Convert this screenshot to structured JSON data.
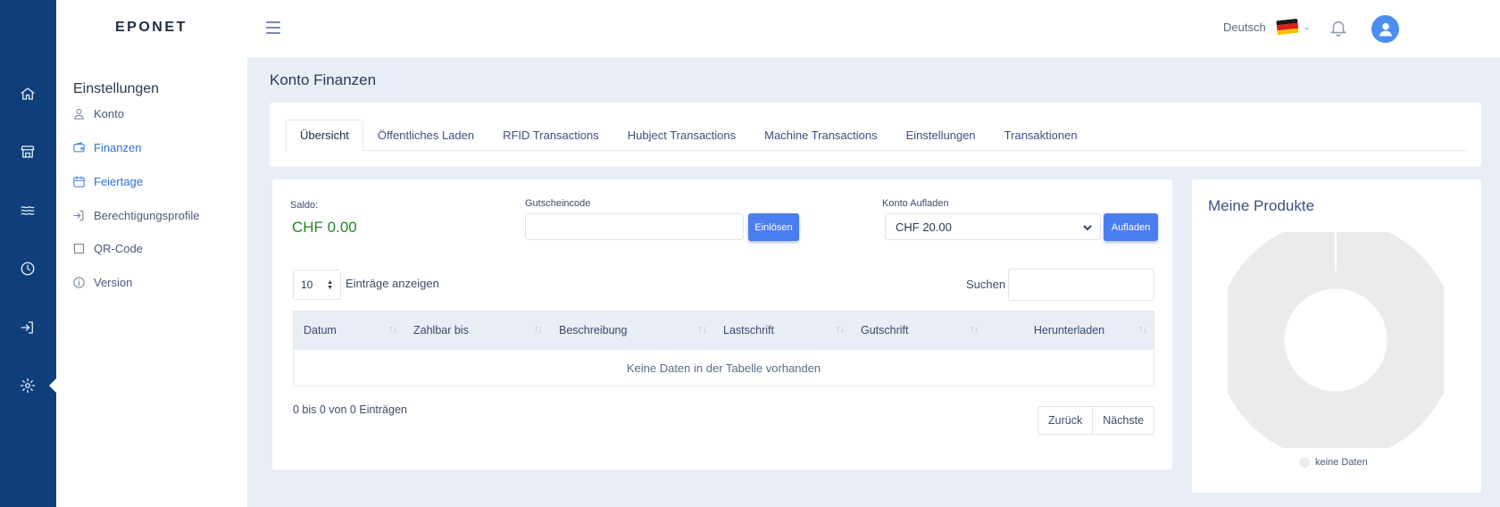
{
  "header": {
    "logo": "EPONET",
    "language": "Deutsch"
  },
  "sidebar": {
    "title": "Einstellungen",
    "items": [
      {
        "label": "Konto",
        "icon": "user-icon"
      },
      {
        "label": "Finanzen",
        "icon": "wallet-icon"
      },
      {
        "label": "Feiertage",
        "icon": "calendar-icon"
      },
      {
        "label": "Berechtigungsprofile",
        "icon": "sign-in-icon"
      },
      {
        "label": "QR-Code",
        "icon": "square-icon"
      },
      {
        "label": "Version",
        "icon": "info-icon"
      }
    ]
  },
  "page": {
    "title": "Konto Finanzen"
  },
  "tabs": [
    "Übersicht",
    "Öffentliches Laden",
    "RFID Transactions",
    "Hubject Transactions",
    "Machine Transactions",
    "Einstellungen",
    "Transaktionen"
  ],
  "finance": {
    "saldo_label": "Saldo:",
    "saldo_value": "CHF 0.00",
    "voucher_label": "Gutscheincode",
    "voucher_value": "",
    "redeem_button": "Einlösen",
    "topup_label": "Konto Aufladen",
    "topup_selected": "CHF 20.00",
    "topup_button": "Aufladen",
    "entries_value": "10",
    "entries_label": "Einträge anzeigen",
    "search_label": "Suchen",
    "search_value": ""
  },
  "table": {
    "columns": [
      "Datum",
      "Zahlbar bis",
      "Beschreibung",
      "Lastschrift",
      "Gutschrift",
      "Herunterladen"
    ],
    "empty_message": "Keine Daten in der Tabelle vorhanden",
    "info": "0 bis 0 von 0 Einträgen",
    "prev_button": "Zurück",
    "next_button": "Nächste"
  },
  "products": {
    "title": "Meine Produkte",
    "legend": "keine Daten"
  },
  "colors": {
    "rail": "#0f3f7a",
    "accent": "#4a7df0",
    "saldo": "#1f8a1f",
    "donut": "#ebebeb"
  }
}
